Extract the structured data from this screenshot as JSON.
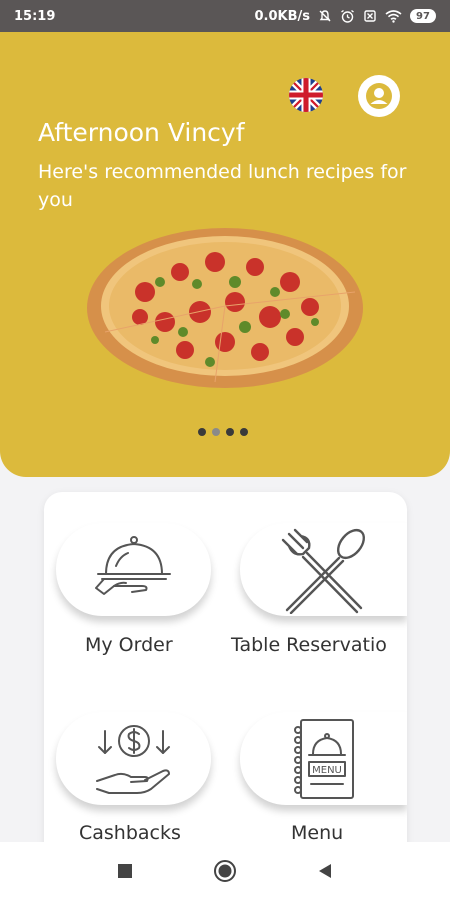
{
  "status_bar": {
    "time": "15:19",
    "network_speed": "0.0KB/s",
    "battery": "97",
    "icons": [
      "mute-bell-icon",
      "alarm-icon",
      "sim-icon",
      "wifi-icon",
      "battery-icon"
    ]
  },
  "header": {
    "language_flag": "uk-flag-icon",
    "profile_icon": "user-profile-icon",
    "greeting": "Afternoon Vincyf",
    "subtitle": "Here's recommended lunch recipes for you",
    "banner_image": "pizza-image",
    "carousel": {
      "count": 4,
      "active_index": 1
    },
    "accent_color": "#dcba3c"
  },
  "menu": {
    "items": [
      {
        "label": "My Order",
        "icon": "serving-cloche-hand-icon"
      },
      {
        "label": "Table Reservatio",
        "icon": "fork-spoon-icon"
      },
      {
        "label": "Cashbacks",
        "icon": "cashback-dollar-hand-icon"
      },
      {
        "label": "Menu",
        "icon": "menu-book-icon"
      }
    ]
  },
  "nav_bar": {
    "buttons": [
      "recent-apps-icon",
      "home-icon",
      "back-icon"
    ]
  }
}
